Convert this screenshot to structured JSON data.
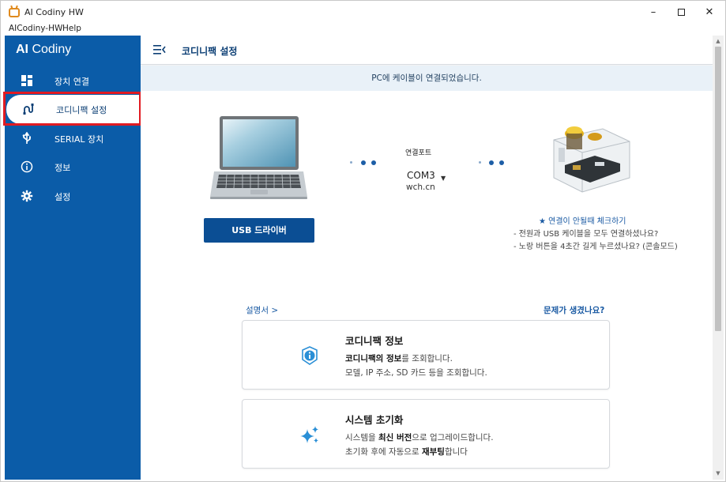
{
  "window": {
    "title": "AI Codiny HW",
    "controls": {
      "minimize": "–",
      "maximize": "",
      "close": "✕"
    }
  },
  "menubar": {
    "items": [
      "AICodiny-HW",
      "Help"
    ]
  },
  "sidebar": {
    "brand_strong": "AI",
    "brand_rest": " Codiny",
    "items": [
      {
        "label": "장치 연결",
        "icon": "dashboard-icon"
      },
      {
        "label": "코디니팩 설정",
        "icon": "wire-plug-icon",
        "active": true
      },
      {
        "label": "SERIAL 장치",
        "icon": "usb-icon"
      },
      {
        "label": "정보",
        "icon": "info-icon"
      },
      {
        "label": "설정",
        "icon": "gear-icon"
      }
    ],
    "accent": "#0b5ca8",
    "highlight_color": "#e11b22"
  },
  "header": {
    "title": "코디니팩 설정"
  },
  "status": {
    "message": "PC에 케이블이 연결되었습니다."
  },
  "connection": {
    "usb_driver_button": "USB 드라이버",
    "port_label": "연결포트",
    "port_value": "COM3",
    "port_sub": "wch.cn",
    "check_title": "★ 연결이 안될때 체크하기",
    "check_lines": [
      "- 전원과 USB 케이블을 모두 연결하셨나요?",
      "- 노랑 버튼을 4초간 길게 누르셨나요? (콘솔모드)"
    ]
  },
  "links": {
    "manual": "설명서  >",
    "problem": "문제가 생겼나요?"
  },
  "cards": [
    {
      "icon": "info-circle-icon",
      "title": "코디니팩 정보",
      "line1_bold": "코디니팩의 정보",
      "line1_rest": "를 조회합니다.",
      "line2": "모델, IP 주소, SD 카드 등을 조회합니다."
    },
    {
      "icon": "sparkle-icon",
      "title": "시스템 초기화",
      "line1_pre": "시스템을 ",
      "line1_bold": "최신 버전",
      "line1_rest": "으로 업그레이드합니다.",
      "line2_pre": "초기화 후에 자동으로 ",
      "line2_bold": "재부팅",
      "line2_rest": "합니다"
    }
  ]
}
